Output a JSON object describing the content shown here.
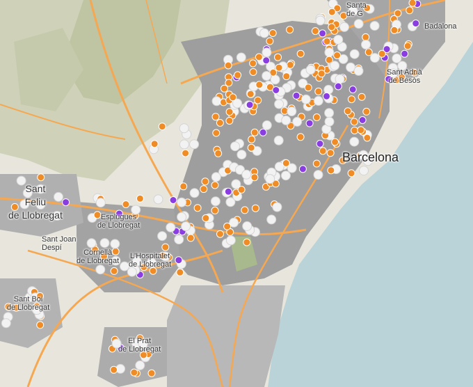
{
  "map": {
    "labels": {
      "barcelona": "Barcelona",
      "santa_coloma": "Santa\nde G",
      "badalona": "Badalona",
      "sant_adria": "Sant Adrià\nde Besòs",
      "sant_feliu": "Sant\nFeliu\nde Llobregat",
      "sant_joan_despi": "Sant Joan\nDespí",
      "esplugues": "Esplugues\nde Llobregat",
      "cornella": "Cornellà\nde Llobregat",
      "hospitalet": "L'Hospitalet\nde Llobregat",
      "sant_boi": "Sant Boi\nde Llobregat",
      "prat": "El Prat\nde Llobregat"
    },
    "colors": {
      "land": "#e8e6dc",
      "relief": "#c9cdb0",
      "urban": "#9b9b9b",
      "urban_light": "#bdbdbd",
      "sea": "#b9d3d8",
      "road": "#f5a851",
      "marker_orange": "#ef8c25",
      "marker_purple": "#8a3de0",
      "marker_white": "#f2f2f2"
    }
  }
}
